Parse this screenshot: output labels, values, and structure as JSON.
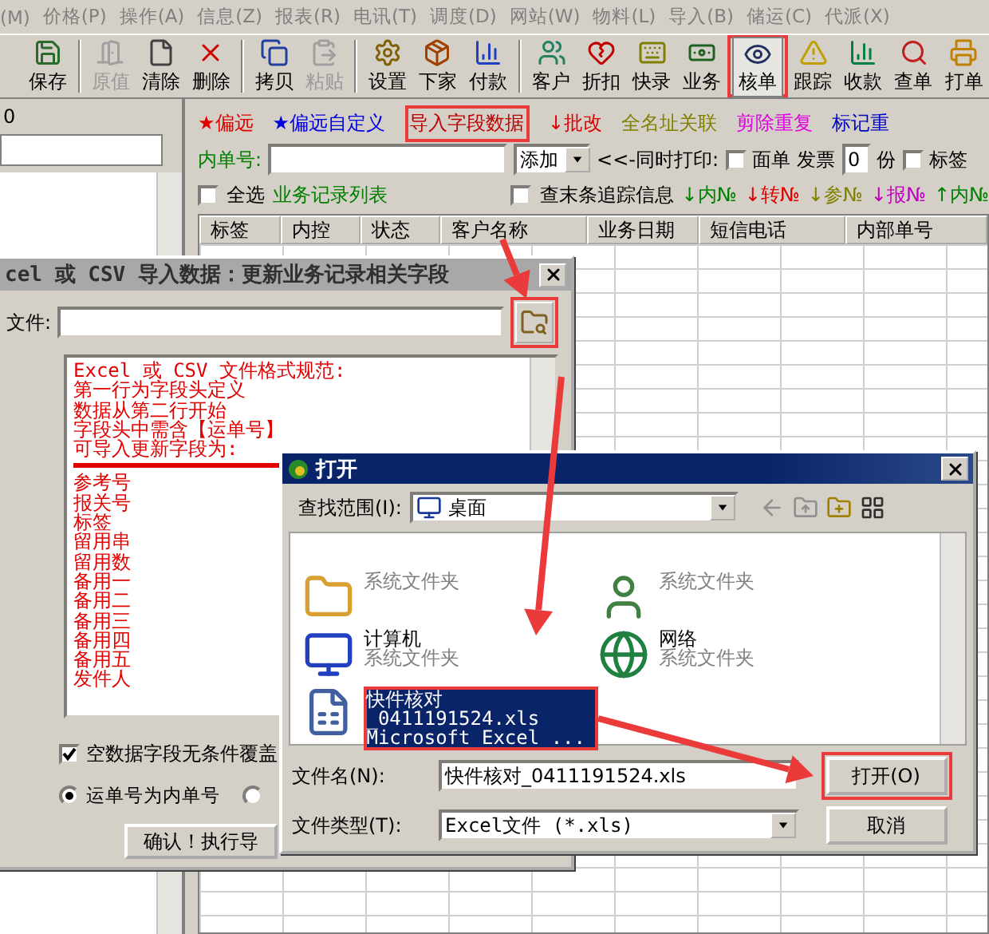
{
  "menu": [
    {
      "label": "(M)"
    },
    {
      "label": "价格(P)"
    },
    {
      "label": "操作(A)"
    },
    {
      "label": "信息(Z)"
    },
    {
      "label": "报表(R)"
    },
    {
      "label": "电讯(T)"
    },
    {
      "label": "调度(D)"
    },
    {
      "label": "网站(W)"
    },
    {
      "label": "物料(L)"
    },
    {
      "label": "导入(B)"
    },
    {
      "label": "储运(C)"
    },
    {
      "label": "代派(X)"
    }
  ],
  "toolbar": [
    {
      "label": "保存",
      "disabled": false,
      "selected": false
    },
    {
      "label": "原值",
      "disabled": true,
      "selected": false
    },
    {
      "label": "清除",
      "disabled": false,
      "selected": false
    },
    {
      "label": "删除",
      "disabled": false,
      "selected": false
    },
    {
      "label": "拷贝",
      "disabled": false,
      "selected": false
    },
    {
      "label": "粘贴",
      "disabled": true,
      "selected": false
    },
    {
      "label": "设置",
      "disabled": false,
      "selected": false
    },
    {
      "label": "下家",
      "disabled": false,
      "selected": false
    },
    {
      "label": "付款",
      "disabled": false,
      "selected": false
    },
    {
      "label": "客户",
      "disabled": false,
      "selected": false
    },
    {
      "label": "折扣",
      "disabled": false,
      "selected": false
    },
    {
      "label": "快录",
      "disabled": false,
      "selected": false
    },
    {
      "label": "业务",
      "disabled": false,
      "selected": false
    },
    {
      "label": "核单",
      "disabled": false,
      "selected": true
    },
    {
      "label": "跟踪",
      "disabled": false,
      "selected": false
    },
    {
      "label": "收款",
      "disabled": false,
      "selected": false
    },
    {
      "label": "查单",
      "disabled": false,
      "selected": false
    },
    {
      "label": "打单",
      "disabled": false,
      "selected": false
    }
  ],
  "left_panel": {
    "header": "0"
  },
  "quick_links": [
    {
      "text": "★偏远",
      "color": "#e00000"
    },
    {
      "text": "★偏远自定义",
      "color": "#0000e0"
    },
    {
      "text": "导入字段数据",
      "color": "#c00000"
    },
    {
      "text": "↓批改",
      "color": "#e00000"
    },
    {
      "text": "全名址关联",
      "color": "#808000"
    },
    {
      "text": "剪除重复",
      "color": "#e000e0"
    },
    {
      "text": "标记重",
      "color": "#0000c0"
    }
  ],
  "order_row": {
    "label": "内单号:",
    "mode": "添加",
    "print_label": "<<-同时打印:",
    "waybill": {
      "label": "面单",
      "checked": false
    },
    "invoice_label": "发票",
    "invoice_count": "0",
    "unit": "份",
    "tag": {
      "label": "标签",
      "checked": false
    }
  },
  "list_row": {
    "select_all": {
      "label": "全选",
      "checked": false
    },
    "title": "业务记录列表",
    "trace": {
      "label": "查末条追踪信息",
      "checked": false
    },
    "sort_links": [
      {
        "text": "↓内№",
        "color": "#008000"
      },
      {
        "text": "↓转№",
        "color": "#e00000"
      },
      {
        "text": "↓参№",
        "color": "#808000"
      },
      {
        "text": "↓报№",
        "color": "#c000c0"
      },
      {
        "text": "↑内№",
        "color": "#008000"
      }
    ]
  },
  "table": {
    "columns": [
      "标签",
      "内控",
      "状态",
      "客户名称",
      "业务日期",
      "短信电话",
      "内部单号"
    ]
  },
  "import_dialog": {
    "title": "cel 或 CSV 导入数据：更新业务记录相关字段",
    "file_label": "文件:",
    "notes_head": [
      "Excel 或 CSV 文件格式规范:",
      "第一行为字段头定义",
      "数据从第二行开始",
      "字段头中需含【运单号】",
      "可导入更新字段为:"
    ],
    "notes_fields": [
      "参考号",
      "报关号",
      "标签",
      "留用串",
      "留用数",
      "备用一",
      "备用二",
      "备用三",
      "备用四",
      "备用五",
      "发件人"
    ],
    "overwrite": {
      "label": "空数据字段无条件覆盖",
      "checked": true
    },
    "options": [
      {
        "label": "运单号为内单号",
        "selected": true
      },
      {
        "selected": false
      }
    ],
    "confirm": "确认！执行导"
  },
  "open_dialog": {
    "title": "打开",
    "look_in_label": "查找范围(I):",
    "look_in": "桌面",
    "items": [
      {
        "subtitle": "系统文件夹",
        "selected": false
      },
      {
        "subtitle": "系统文件夹",
        "selected": false
      },
      {
        "name": "计算机",
        "subtitle": "系统文件夹",
        "selected": false
      },
      {
        "name": "网络",
        "subtitle": "系统文件夹",
        "selected": false
      },
      {
        "name": "快件核对",
        "lines": [
          "_0411191524.xls",
          "Microsoft Excel ..."
        ],
        "selected": true
      }
    ],
    "file_name_label": "文件名(N):",
    "file_name": "快件核对_0411191524.xls",
    "file_type_label": "文件类型(T):",
    "file_type": "Excel文件 (*.xls)",
    "open": "打开(O)",
    "cancel": "取消"
  }
}
